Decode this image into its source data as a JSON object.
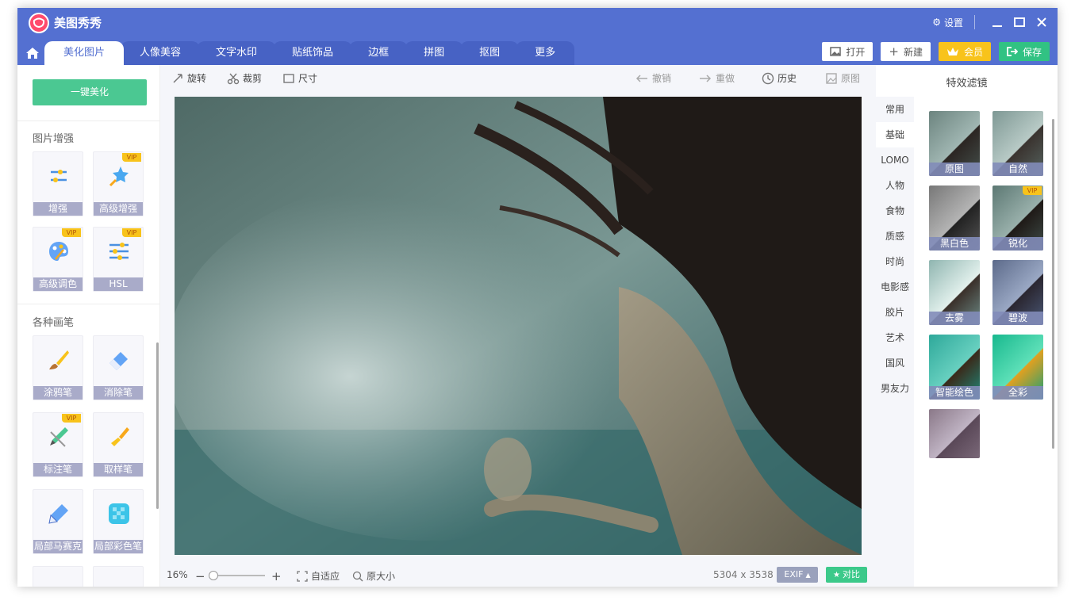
{
  "app": {
    "title": "美图秀秀"
  },
  "window": {
    "settings_label": "设置"
  },
  "nav": {
    "tabs": [
      "美化图片",
      "人像美容",
      "文字水印",
      "贴纸饰品",
      "边框",
      "拼图",
      "抠图",
      "更多"
    ],
    "active_tab": "美化图片"
  },
  "actions": {
    "open": "打开",
    "new": "新建",
    "vip": "会员",
    "save": "保存"
  },
  "left_panel": {
    "one_click": "一键美化",
    "section_enhance": "图片增强",
    "enhance_tools": [
      "增强",
      "高级增强",
      "高级调色",
      "HSL"
    ],
    "section_brush": "各种画笔",
    "brush_tools": [
      "涂鸦笔",
      "消除笔",
      "标注笔",
      "取样笔",
      "局部马赛克",
      "局部彩色笔"
    ],
    "vip_badge": "VIP"
  },
  "toolbar": {
    "rotate": "旋转",
    "crop": "裁剪",
    "size": "尺寸",
    "undo": "撤销",
    "redo": "重做",
    "history": "历史",
    "original": "原图"
  },
  "status": {
    "zoom": "16%",
    "fit": "自适应",
    "actual": "原大小",
    "dimensions": "5304 x 3538",
    "exif": "EXIF",
    "compare": "对比"
  },
  "right_panel": {
    "title": "特效滤镜",
    "categories": [
      "常用",
      "基础",
      "LOMO",
      "人物",
      "食物",
      "质感",
      "时尚",
      "电影感",
      "胶片",
      "艺术",
      "国风",
      "男友力"
    ],
    "active_category": "基础",
    "filters": [
      "原图",
      "自然",
      "黑白色",
      "锐化",
      "去雾",
      "碧波",
      "智能绘色",
      "全彩"
    ]
  },
  "colors": {
    "accent": "#5470d1",
    "green": "#4bc892",
    "gold": "#f8c31b"
  }
}
